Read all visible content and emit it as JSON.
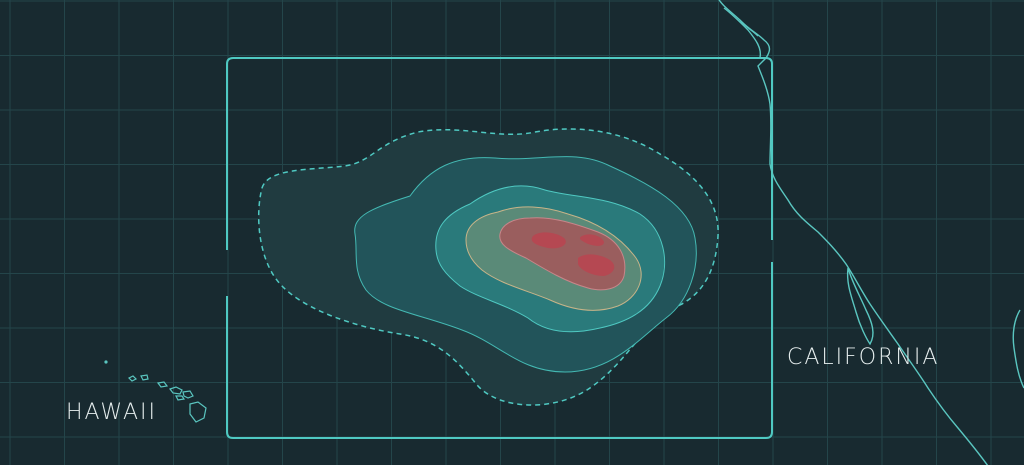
{
  "map": {
    "labels": {
      "hawaii": "HAWAII",
      "california": "CALIFORNIA"
    },
    "colors": {
      "ocean": "#182a30",
      "grid": "#24454a",
      "outline": "#4fc9c2",
      "coastline": "#5ac6c0",
      "contour_outer": "#223f43",
      "contour_2": "#245a5d",
      "contour_3": "#2b7f80",
      "contour_4": "#4e8a7c",
      "contour_5": "#8a5a5c",
      "contour_core": "#b24a55"
    }
  }
}
